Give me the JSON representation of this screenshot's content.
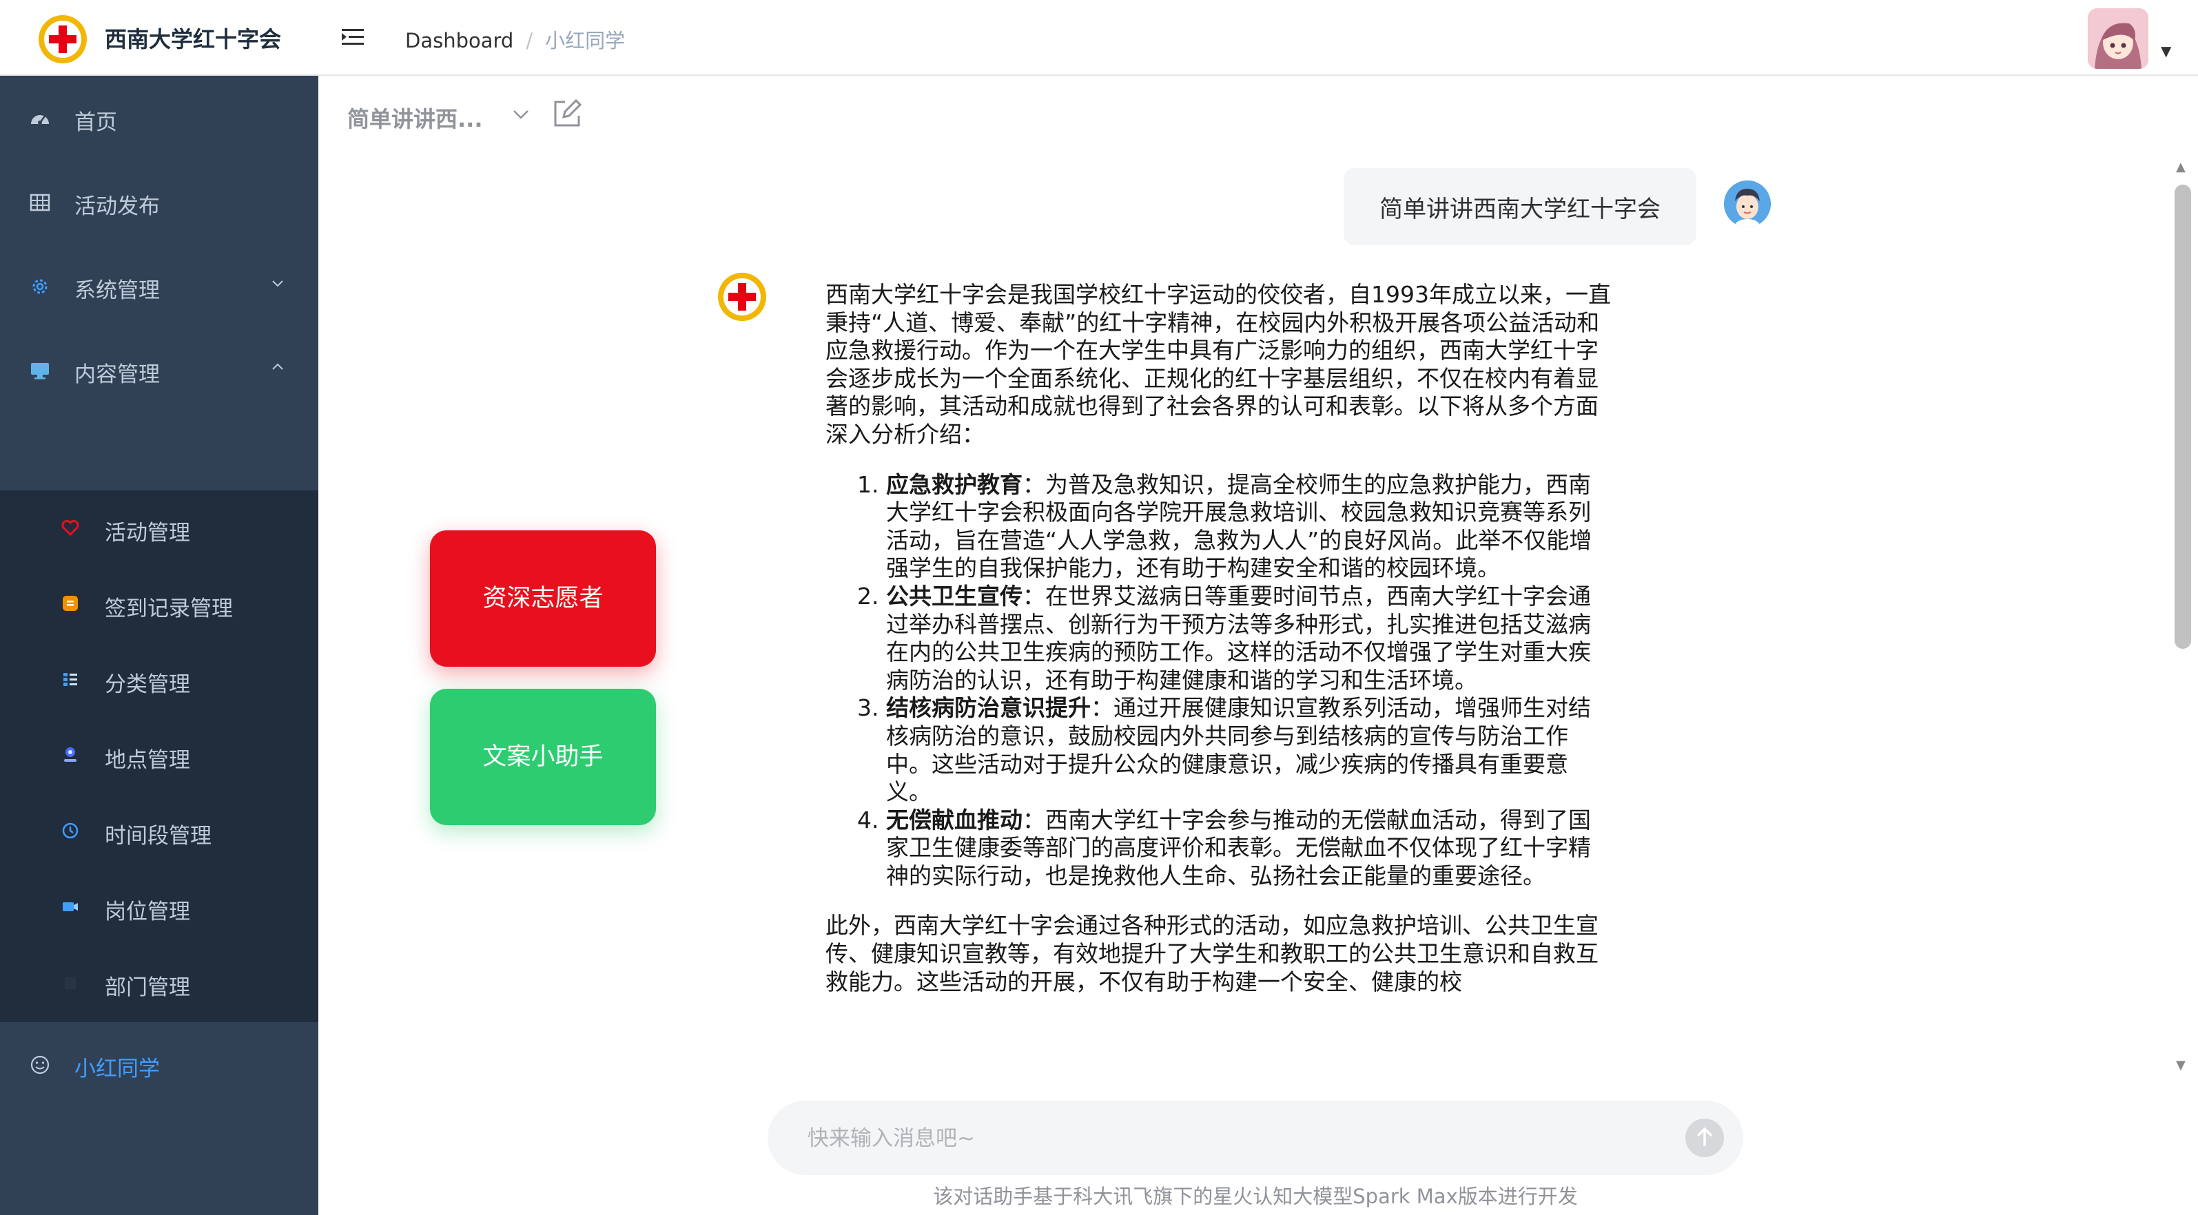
{
  "header": {
    "app_title": "西南大学红十字会",
    "breadcrumb": [
      "Dashboard",
      "小红同学"
    ]
  },
  "sidebar": {
    "items": [
      {
        "label": "首页",
        "icon": "dashboard-icon"
      },
      {
        "label": "活动发布",
        "icon": "table-icon"
      },
      {
        "label": "系统管理",
        "icon": "gear-icon",
        "expanded": false
      },
      {
        "label": "内容管理",
        "icon": "monitor-icon",
        "expanded": true
      }
    ],
    "subitems": [
      {
        "label": "活动管理",
        "icon": "heart-icon",
        "color": "#e8101e"
      },
      {
        "label": "签到记录管理",
        "icon": "clipboard-icon",
        "color": "#f29100"
      },
      {
        "label": "分类管理",
        "icon": "list-icon",
        "color": "#409eff"
      },
      {
        "label": "地点管理",
        "icon": "person-icon",
        "color": "#4a6cf7"
      },
      {
        "label": "时间段管理",
        "icon": "clock-icon",
        "color": "#409eff"
      },
      {
        "label": "岗位管理",
        "icon": "camera-icon",
        "color": "#409eff"
      },
      {
        "label": "部门管理",
        "icon": "building-icon",
        "color": "#263445"
      }
    ],
    "active_item": {
      "label": "小红同学",
      "icon": "smile-icon"
    }
  },
  "chat": {
    "title": "简单讲讲西...",
    "user_message": "简单讲讲西南大学红十字会",
    "bot_intro": "西南大学红十字会是我国学校红十字运动的佼佼者，自1993年成立以来，一直秉持“人道、博爱、奉献”的红十字精神，在校园内外积极开展各项公益活动和应急救援行动。作为一个在大学生中具有广泛影响力的组织，西南大学红十字会逐步成长为一个全面系统化、正规化的红十字基层组织，不仅在校内有着显著的影响，其活动和成就也得到了社会各界的认可和表彰。以下将从多个方面深入分析介绍：",
    "bot_points": [
      {
        "title": "应急救护教育",
        "text": "：为普及急救知识，提高全校师生的应急救护能力，西南大学红十字会积极面向各学院开展急救培训、校园急救知识竞赛等系列活动，旨在营造“人人学急救，急救为人人”的良好风尚。此举不仅能增强学生的自我保护能力，还有助于构建安全和谐的校园环境。"
      },
      {
        "title": "公共卫生宣传",
        "text": "：在世界艾滋病日等重要时间节点，西南大学红十字会通过举办科普摆点、创新行为干预方法等多种形式，扎实推进包括艾滋病在内的公共卫生疾病的预防工作。这样的活动不仅增强了学生对重大疾病防治的认识，还有助于构建健康和谐的学习和生活环境。"
      },
      {
        "title": "结核病防治意识提升",
        "text": "：通过开展健康知识宣教系列活动，增强师生对结核病防治的意识，鼓励校园内外共同参与到结核病的宣传与防治工作中。这些活动对于提升公众的健康意识，减少疾病的传播具有重要意义。"
      },
      {
        "title": "无偿献血推动",
        "text": "：西南大学红十字会参与推动的无偿献血活动，得到了国家卫生健康委等部门的高度评价和表彰。无偿献血不仅体现了红十字精神的实际行动，也是挽救他人生命、弘扬社会正能量的重要途径。"
      }
    ],
    "bot_outro": "此外，西南大学红十字会通过各种形式的活动，如应急救护培训、公共卫生宣传、健康知识宣教等，有效地提升了大学生和教职工的公共卫生意识和自救互救能力。这些活动的开展，不仅有助于构建一个安全、健康的校"
  },
  "side_buttons": {
    "red_label": "资深志愿者",
    "green_label": "文案小助手"
  },
  "input": {
    "placeholder": "快来输入消息吧~",
    "value": ""
  },
  "footer_note": "该对话助手基于科大讯飞旗下的星火认知大模型Spark Max版本进行开发",
  "colors": {
    "sidebar_bg": "#304156",
    "submenu_bg": "#1f2d3d",
    "active": "#409eff",
    "red_button": "#e8101e",
    "green_button": "#2ecc71"
  }
}
